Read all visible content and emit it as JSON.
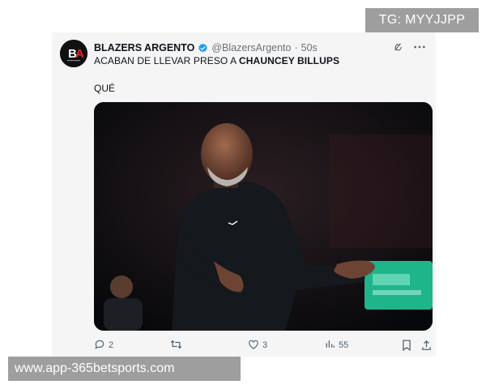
{
  "watermark_top": "TG: MYYJJPP",
  "watermark_bottom": "www.app-365betsports.com",
  "tweet": {
    "avatar_text": "BA",
    "display_name": "BLAZERS ARGENTO",
    "handle": "@BlazersArgento",
    "separator": "·",
    "time": "50s",
    "text_prefix": "ACABAN DE LLEVAR PRESO A ",
    "text_bold": "CHAUNCEY BILLUPS",
    "text_line2": "QUÉ",
    "metrics": {
      "replies": "2",
      "reposts": "",
      "likes": "3",
      "views": "55"
    }
  },
  "icons": {
    "verified": "verified-badge-icon",
    "grok": "grok-icon",
    "more": "more-icon",
    "reply": "reply-icon",
    "repost": "repost-icon",
    "like": "like-icon",
    "views": "views-icon",
    "bookmark": "bookmark-icon",
    "share": "share-icon"
  },
  "colors": {
    "verified_blue": "#1d9bf0",
    "text": "#0f1419",
    "muted": "#536471",
    "card_bg": "#f5f5f6",
    "watermark_bg": "#9e9e9e"
  }
}
